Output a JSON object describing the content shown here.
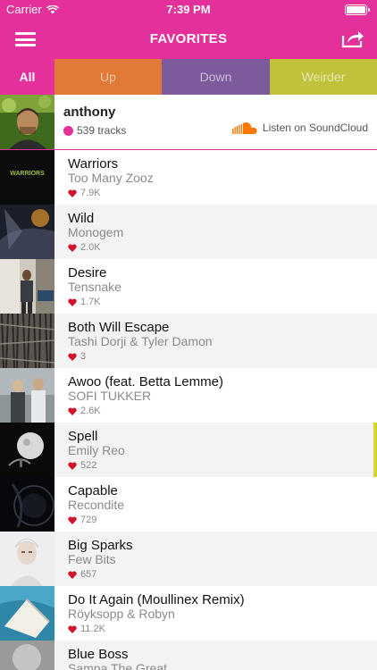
{
  "status_bar": {
    "carrier": "Carrier",
    "time": "7:39 PM",
    "battery_level": 1.0
  },
  "navbar": {
    "title": "FAVORITES",
    "menu_icon": "hamburger-menu-icon",
    "share_icon": "share-icon",
    "background_color": "#e4309b"
  },
  "tabs": [
    {
      "label": "All",
      "color": "#e4309b",
      "active": true
    },
    {
      "label": "Up",
      "color": "#e07a36",
      "active": false
    },
    {
      "label": "Down",
      "color": "#7d5a9c",
      "active": false
    },
    {
      "label": "Weirder",
      "color": "#bfc23a",
      "active": false
    }
  ],
  "profile": {
    "name": "anthony",
    "tracks": "539 tracks",
    "soundcloud_label": "Listen on SoundCloud",
    "soundcloud_color": "#ff7700"
  },
  "tracks": [
    {
      "title": "Warriors",
      "artist": "Too Many Zooz",
      "likes": "7.9K",
      "art_text": "WARRIORS"
    },
    {
      "title": "Wild",
      "artist": "Monogem",
      "likes": "2.0K"
    },
    {
      "title": "Desire",
      "artist": "Tensnake",
      "likes": "1.7K"
    },
    {
      "title": "Both Will Escape",
      "artist": "Tashi Dorji & Tyler Damon",
      "likes": "3"
    },
    {
      "title": "Awoo (feat. Betta Lemme)",
      "artist": "SOFI TUKKER",
      "likes": "2.6K"
    },
    {
      "title": "Spell",
      "artist": "Emily Reo",
      "likes": "522",
      "now_playing": true
    },
    {
      "title": "Capable",
      "artist": "Recondite",
      "likes": "729"
    },
    {
      "title": "Big Sparks",
      "artist": "Few Bits",
      "likes": "657"
    },
    {
      "title": "Do It Again (Moullinex Remix)",
      "artist": "Röyksopp & Robyn",
      "likes": "11.2K"
    },
    {
      "title": "Blue Boss",
      "artist": "Sampa The Great",
      "likes": ""
    }
  ],
  "colors": {
    "accent": "#e4309b",
    "heart": "#d0122a",
    "now_playing_bar": "#d5d53a"
  }
}
